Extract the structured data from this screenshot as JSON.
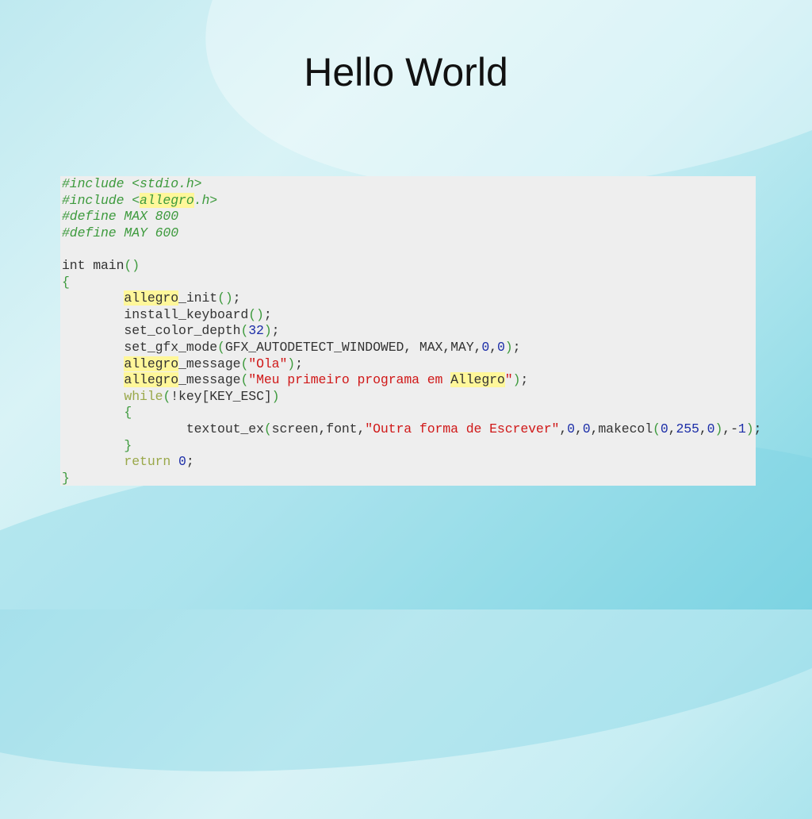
{
  "slide": {
    "title": "Hello World"
  },
  "colors": {
    "preprocessor": "#3d9a3d",
    "string": "#d01818",
    "number": "#1c2ea8",
    "keyword": "#9aa84a",
    "highlight": "#fff79a",
    "panel": "#eeeeee"
  },
  "code_lines": [
    [
      [
        "#include <stdio.h>",
        "pp"
      ]
    ],
    [
      [
        "#include <",
        "pp"
      ],
      [
        "allegro",
        "ppi"
      ],
      [
        ".h>",
        "pp"
      ]
    ],
    [
      [
        "#define MAX 800",
        "pp"
      ]
    ],
    [
      [
        "#define MAY 600",
        "pp"
      ]
    ],
    [],
    [
      [
        "int main",
        "typ"
      ],
      [
        "()",
        "par"
      ]
    ],
    [
      [
        "{",
        "par"
      ]
    ],
    [
      [
        "        ",
        ""
      ],
      [
        "allegro",
        "hl"
      ],
      [
        "_init",
        ""
      ],
      [
        "()",
        "par"
      ],
      [
        ";",
        ""
      ]
    ],
    [
      [
        "        install_keyboard",
        ""
      ],
      [
        "()",
        "par"
      ],
      [
        ";",
        ""
      ]
    ],
    [
      [
        "        set_color_depth",
        ""
      ],
      [
        "(",
        "par"
      ],
      [
        "32",
        "num"
      ],
      [
        ")",
        "par"
      ],
      [
        ";",
        ""
      ]
    ],
    [
      [
        "        set_gfx_mode",
        ""
      ],
      [
        "(",
        "par"
      ],
      [
        "GFX_AUTODETECT_WINDOWED, MAX,MAY,",
        ""
      ],
      [
        "0",
        "num"
      ],
      [
        ",",
        ""
      ],
      [
        "0",
        "num"
      ],
      [
        ")",
        "par"
      ],
      [
        ";",
        ""
      ]
    ],
    [
      [
        "        ",
        ""
      ],
      [
        "allegro",
        "hl"
      ],
      [
        "_message",
        ""
      ],
      [
        "(",
        "par"
      ],
      [
        "\"Ola\"",
        "str"
      ],
      [
        ")",
        "par"
      ],
      [
        ";",
        ""
      ]
    ],
    [
      [
        "        ",
        ""
      ],
      [
        "allegro",
        "hl"
      ],
      [
        "_message",
        ""
      ],
      [
        "(",
        "par"
      ],
      [
        "\"Meu primeiro programa em ",
        "str"
      ],
      [
        "Allegro",
        "hl"
      ],
      [
        "\"",
        "str"
      ],
      [
        ")",
        "par"
      ],
      [
        ";",
        ""
      ]
    ],
    [
      [
        "        ",
        ""
      ],
      [
        "while",
        "kw"
      ],
      [
        "(",
        "par"
      ],
      [
        "!key[KEY_ESC]",
        ""
      ],
      [
        ")",
        "par"
      ]
    ],
    [
      [
        "        ",
        ""
      ],
      [
        "{",
        "par"
      ]
    ],
    [
      [
        "                textout_ex",
        ""
      ],
      [
        "(",
        "par"
      ],
      [
        "screen,font,",
        ""
      ],
      [
        "\"Outra forma de Escrever\"",
        "str"
      ],
      [
        ",",
        ""
      ],
      [
        "0",
        "num"
      ],
      [
        ",",
        ""
      ],
      [
        "0",
        "num"
      ],
      [
        ",makecol",
        ""
      ],
      [
        "(",
        "par"
      ],
      [
        "0",
        "num"
      ],
      [
        ",",
        ""
      ],
      [
        "255",
        "num"
      ],
      [
        ",",
        ""
      ],
      [
        "0",
        "num"
      ],
      [
        ")",
        "par"
      ],
      [
        ",-",
        ""
      ],
      [
        "1",
        "num"
      ],
      [
        ")",
        "par"
      ],
      [
        ";",
        ""
      ]
    ],
    [
      [
        "        ",
        ""
      ],
      [
        "}",
        "par"
      ]
    ],
    [
      [
        "        ",
        ""
      ],
      [
        "return",
        "kw"
      ],
      [
        " ",
        ""
      ],
      [
        "0",
        "num"
      ],
      [
        ";",
        ""
      ]
    ],
    [
      [
        "}",
        "par"
      ]
    ]
  ]
}
